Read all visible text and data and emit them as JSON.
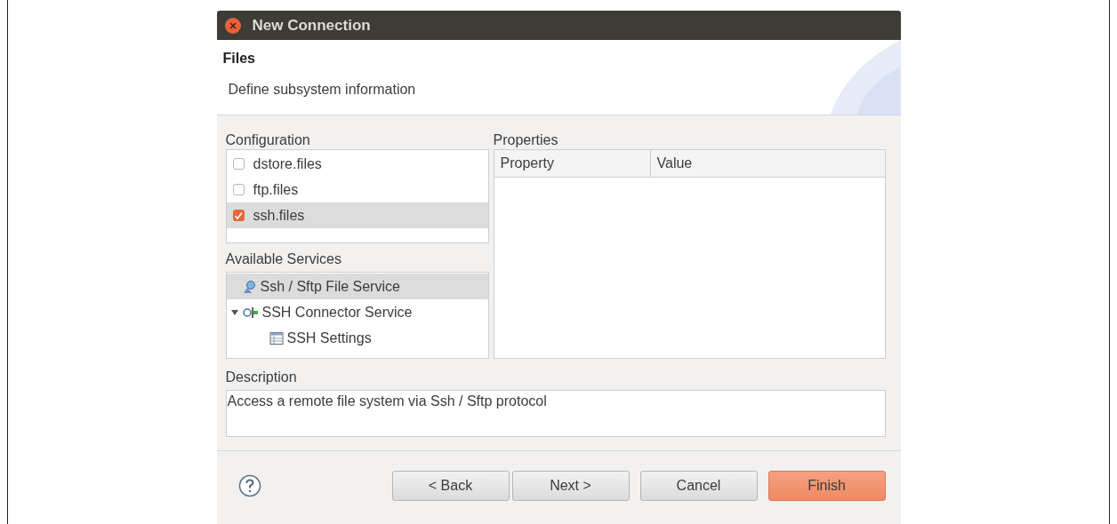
{
  "window": {
    "title": "New Connection"
  },
  "header": {
    "title": "Files",
    "subtitle": "Define subsystem information"
  },
  "configuration": {
    "label": "Configuration",
    "items": [
      {
        "label": "dstore.files",
        "checked": false,
        "selected": false
      },
      {
        "label": "ftp.files",
        "checked": false,
        "selected": false
      },
      {
        "label": "ssh.files",
        "checked": true,
        "selected": true
      }
    ]
  },
  "available_services": {
    "label": "Available Services",
    "items": [
      {
        "label": "Ssh / Sftp File Service",
        "kind": "file-service",
        "selected": true
      },
      {
        "label": "SSH Connector Service",
        "kind": "connector",
        "selected": false,
        "expanded": true,
        "children": [
          {
            "label": "SSH Settings",
            "kind": "settings",
            "selected": false
          }
        ]
      }
    ]
  },
  "properties": {
    "label": "Properties",
    "columns": [
      "Property",
      "Value"
    ]
  },
  "description": {
    "label": "Description",
    "text": "Access a remote file system via Ssh / Sftp protocol"
  },
  "buttons": [
    {
      "label": "< Back",
      "default": false
    },
    {
      "label": "Next >",
      "default": false
    },
    {
      "label": "Cancel",
      "default": false
    },
    {
      "label": "Finish",
      "default": true
    }
  ]
}
